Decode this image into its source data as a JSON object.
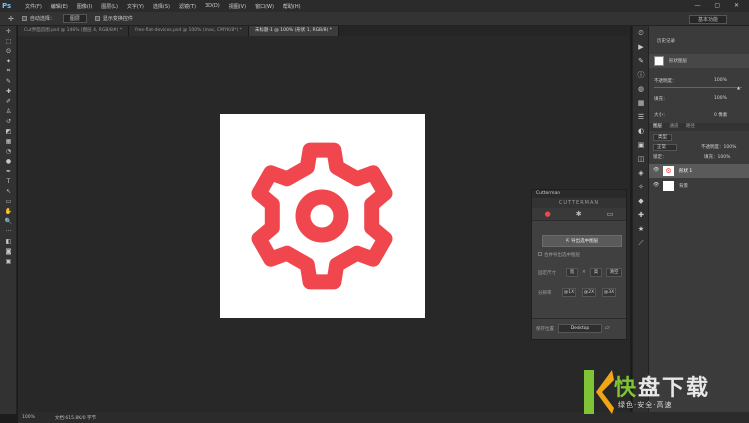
{
  "menubar": {
    "app": "Ps",
    "items": [
      "文件(F)",
      "编辑(E)",
      "图像(I)",
      "图层(L)",
      "文字(Y)",
      "选择(S)",
      "滤镜(T)",
      "3D(D)",
      "视图(V)",
      "窗口(W)",
      "帮助(H)"
    ],
    "window_controls": "— ▢ ✕"
  },
  "options": {
    "tool_icon": "✛",
    "auto_select": "自动选择：",
    "auto_select_value": "图层",
    "show_transform": "显示变换控件",
    "workspace": "基本功能"
  },
  "tabs": [
    {
      "label": "Cut界面首图.psd @ 146% (图层 4, RGB/8#) *"
    },
    {
      "label": "free-flat-devices.psd @ 100% (mac, CMYK/8*) *"
    },
    {
      "label": "未标题-1 @ 100% (形状 1, RGB/8) *",
      "active": true
    }
  ],
  "toolbar": {
    "icons": [
      "move-icon",
      "marquee-icon",
      "lasso-icon",
      "magic-wand-icon",
      "crop-icon",
      "eyedropper-icon",
      "healing-icon",
      "brush-icon",
      "stamp-icon",
      "history-brush-icon",
      "eraser-icon",
      "gradient-icon",
      "blur-icon",
      "dodge-icon",
      "pen-icon",
      "type-icon",
      "path-select-icon",
      "shape-icon",
      "hand-icon",
      "zoom-icon",
      "more-icon",
      "colors-icon",
      "quickmask-icon",
      "screenmode-icon"
    ],
    "glyphs": [
      "✛",
      "⬚",
      "ʘ",
      "✦",
      "⌗",
      "✎",
      "✚",
      "✐",
      "♙",
      "↺",
      "◩",
      "▦",
      "◔",
      "●",
      "✒",
      "T",
      "↖",
      "▭",
      "✋",
      "🔍",
      "···",
      "◧",
      "◙",
      "▣"
    ]
  },
  "status": {
    "zoom": "100%",
    "doc": "文档:615.8K/0 字节"
  },
  "right_panel": {
    "history_label": "历史记录",
    "history_item": "形状图层",
    "opacity_label": "不透明度：",
    "opacity_value": "100%",
    "fill_label": "填充：",
    "fill_value": "100%",
    "size_label": "大小：",
    "size_value": "0 像素",
    "layers_tabs": [
      "图层",
      "通道",
      "路径"
    ],
    "kind": "类型",
    "blend": "正常",
    "opacity_short": "不透明度：100%",
    "lock": "锁定：",
    "fill_short": "填充：100%",
    "layers": [
      {
        "name": "形状 1",
        "selected": true
      },
      {
        "name": "背景",
        "selected": false
      }
    ]
  },
  "cutterman": {
    "title": "Cutterman",
    "header": "CUTTERMAN",
    "platforms": [
      "apple-icon",
      "android-icon",
      "desktop-icon"
    ],
    "export_button": "导出选中图层",
    "merge_label": "合并导出选中图层",
    "fixed_size_label": "固定尺寸",
    "width_placeholder": "宽",
    "height_placeholder": "高",
    "clear_button": "清空",
    "scale_label": "分辨率",
    "scales": [
      "@1X",
      "@2X",
      "@3X"
    ],
    "save_label": "保存位置",
    "dir": "Desktop"
  },
  "watermark": {
    "brand_a": "快",
    "brand_b": "盘下载",
    "tagline": "绿色·安全·高速"
  },
  "colors": {
    "gear": "#f0474f",
    "accent": "#7ec436"
  }
}
